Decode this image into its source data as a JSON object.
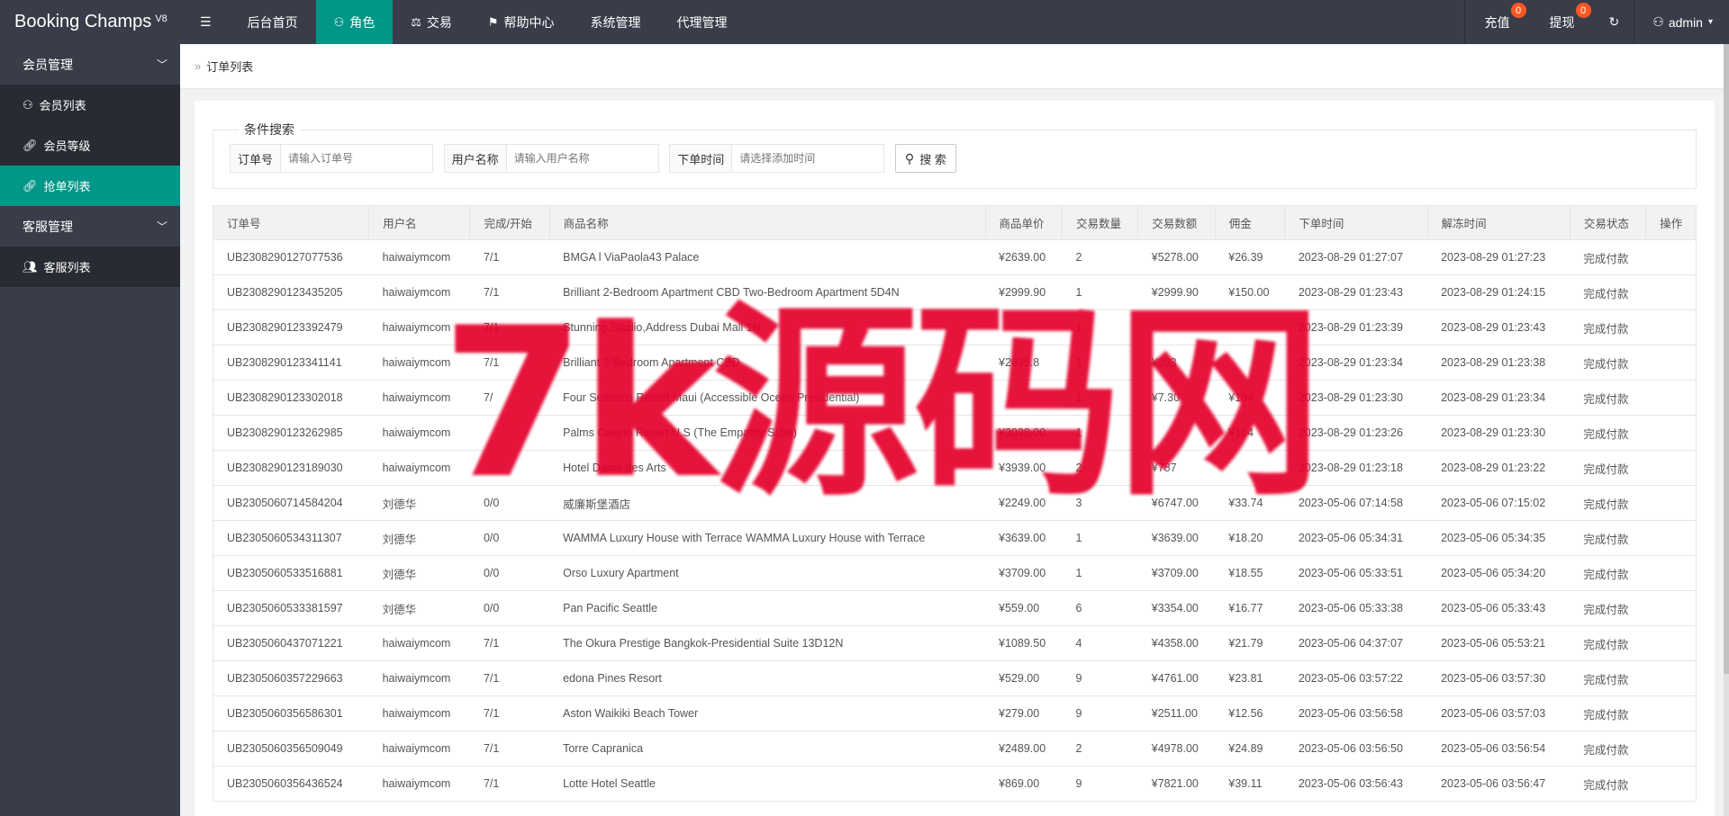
{
  "app": {
    "title": "Booking Champs",
    "version": "V8"
  },
  "topnav": {
    "collapse_icon": "menu-collapse-icon",
    "items": [
      {
        "label": "后台首页",
        "icon": ""
      },
      {
        "label": "角色",
        "icon": "user-icon",
        "active": true
      },
      {
        "label": "交易",
        "icon": "scale-icon"
      },
      {
        "label": "帮助中心",
        "icon": "flag-icon"
      },
      {
        "label": "系统管理",
        "icon": ""
      },
      {
        "label": "代理管理",
        "icon": ""
      }
    ],
    "right": {
      "recharge": {
        "label": "充值",
        "badge": "0"
      },
      "withdraw": {
        "label": "提现",
        "badge": "0"
      },
      "refresh_icon": "refresh-icon",
      "user": {
        "label": "admin"
      }
    }
  },
  "sidebar": {
    "groups": [
      {
        "label": "会员管理",
        "items": [
          {
            "label": "会员列表",
            "icon": "user-icon"
          },
          {
            "label": "会员等级",
            "icon": "link-icon"
          },
          {
            "label": "抢单列表",
            "icon": "link-icon",
            "active": true
          }
        ]
      },
      {
        "label": "客服管理",
        "items": [
          {
            "label": "客服列表",
            "icon": "users-icon"
          }
        ]
      }
    ]
  },
  "breadcrumb": {
    "current": "订单列表"
  },
  "search": {
    "legend": "条件搜索",
    "order_no": {
      "label": "订单号",
      "placeholder": "请输入订单号"
    },
    "username": {
      "label": "用户名称",
      "placeholder": "请输入用户名称"
    },
    "order_time": {
      "label": "下单时间",
      "placeholder": "请选择添加时间"
    },
    "button": "搜 索"
  },
  "table": {
    "headers": [
      "订单号",
      "用户名",
      "完成/开始",
      "商品名称",
      "商品单价",
      "交易数量",
      "交易数额",
      "佣金",
      "下单时间",
      "解冻时间",
      "交易状态",
      "操作"
    ],
    "rows": [
      [
        "UB2308290127077536",
        "haiwaiymcom",
        "7/1",
        "BMGA l ViaPaola43 Palace",
        "¥2639.00",
        "2",
        "¥5278.00",
        "¥26.39",
        "2023-08-29 01:27:07",
        "2023-08-29 01:27:23",
        "完成付款",
        ""
      ],
      [
        "UB2308290123435205",
        "haiwaiymcom",
        "7/1",
        "Brilliant 2-Bedroom Apartment CBD Two-Bedroom Apartment 5D4N",
        "¥2999.90",
        "1",
        "¥2999.90",
        "¥150.00",
        "2023-08-29 01:23:43",
        "2023-08-29 01:24:15",
        "完成付款",
        ""
      ],
      [
        "UB2308290123392479",
        "haiwaiymcom",
        "7/1",
        "Stunning Studio,Address Dubai Mall 1N",
        "",
        "1",
        "",
        "",
        "2023-08-29 01:23:39",
        "2023-08-29 01:23:43",
        "完成付款",
        ""
      ],
      [
        "UB2308290123341141",
        "haiwaiymcom",
        "7/1",
        "Brilliant 2-Bedroom Apartment CBD",
        "¥2039.8",
        "1",
        "¥203",
        "",
        "2023-08-29 01:23:34",
        "2023-08-29 01:23:38",
        "完成付款",
        ""
      ],
      [
        "UB2308290123302018",
        "haiwaiymcom",
        "7/",
        "Four Seasons Resort Maui (Accessible Ocean Presidential)",
        "",
        "1",
        "¥7.30",
        "¥104",
        "2023-08-29 01:23:30",
        "2023-08-29 01:23:34",
        "完成付款",
        ""
      ],
      [
        "UB2308290123262985",
        "haiwaiymcom",
        "",
        "Palms Casino Resort U.S (The Empathy Suite)",
        "¥3038.00",
        "1",
        "",
        "¥154",
        "2023-08-29 01:23:26",
        "2023-08-29 01:23:30",
        "完成付款",
        ""
      ],
      [
        "UB2308290123189030",
        "haiwaiymcom",
        "",
        "Hotel Dame des Arts",
        "¥3939.00",
        "2",
        "¥787",
        "",
        "2023-08-29 01:23:18",
        "2023-08-29 01:23:22",
        "完成付款",
        ""
      ],
      [
        "UB2305060714584204",
        "刘德华",
        "0/0",
        "威廉斯堡酒店",
        "¥2249.00",
        "3",
        "¥6747.00",
        "¥33.74",
        "2023-05-06 07:14:58",
        "2023-05-06 07:15:02",
        "完成付款",
        ""
      ],
      [
        "UB2305060534311307",
        "刘德华",
        "0/0",
        "WAMMA Luxury House with Terrace WAMMA Luxury House with Terrace",
        "¥3639.00",
        "1",
        "¥3639.00",
        "¥18.20",
        "2023-05-06 05:34:31",
        "2023-05-06 05:34:35",
        "完成付款",
        ""
      ],
      [
        "UB2305060533516881",
        "刘德华",
        "0/0",
        "Orso Luxury Apartment",
        "¥3709.00",
        "1",
        "¥3709.00",
        "¥18.55",
        "2023-05-06 05:33:51",
        "2023-05-06 05:34:20",
        "完成付款",
        ""
      ],
      [
        "UB2305060533381597",
        "刘德华",
        "0/0",
        "Pan Pacific Seattle",
        "¥559.00",
        "6",
        "¥3354.00",
        "¥16.77",
        "2023-05-06 05:33:38",
        "2023-05-06 05:33:43",
        "完成付款",
        ""
      ],
      [
        "UB2305060437071221",
        "haiwaiymcom",
        "7/1",
        "The Okura Prestige Bangkok-Presidential Suite 13D12N",
        "¥1089.50",
        "4",
        "¥4358.00",
        "¥21.79",
        "2023-05-06 04:37:07",
        "2023-05-06 05:53:21",
        "完成付款",
        ""
      ],
      [
        "UB2305060357229663",
        "haiwaiymcom",
        "7/1",
        "edona Pines Resort",
        "¥529.00",
        "9",
        "¥4761.00",
        "¥23.81",
        "2023-05-06 03:57:22",
        "2023-05-06 03:57:30",
        "完成付款",
        ""
      ],
      [
        "UB2305060356586301",
        "haiwaiymcom",
        "7/1",
        "Aston Waikiki Beach Tower",
        "¥279.00",
        "9",
        "¥2511.00",
        "¥12.56",
        "2023-05-06 03:56:58",
        "2023-05-06 03:57:03",
        "完成付款",
        ""
      ],
      [
        "UB2305060356509049",
        "haiwaiymcom",
        "7/1",
        "Torre Capranica",
        "¥2489.00",
        "2",
        "¥4978.00",
        "¥24.89",
        "2023-05-06 03:56:50",
        "2023-05-06 03:56:54",
        "完成付款",
        ""
      ],
      [
        "UB2305060356436524",
        "haiwaiymcom",
        "7/1",
        "Lotte Hotel Seattle",
        "¥869.00",
        "9",
        "¥7821.00",
        "¥39.11",
        "2023-05-06 03:56:43",
        "2023-05-06 03:56:47",
        "完成付款",
        ""
      ]
    ]
  },
  "watermark": {
    "text": "7k源码网",
    "color": "#e4002b"
  },
  "colors": {
    "topbar": "#393d49",
    "accent": "#009688",
    "badge": "#ff5722"
  }
}
